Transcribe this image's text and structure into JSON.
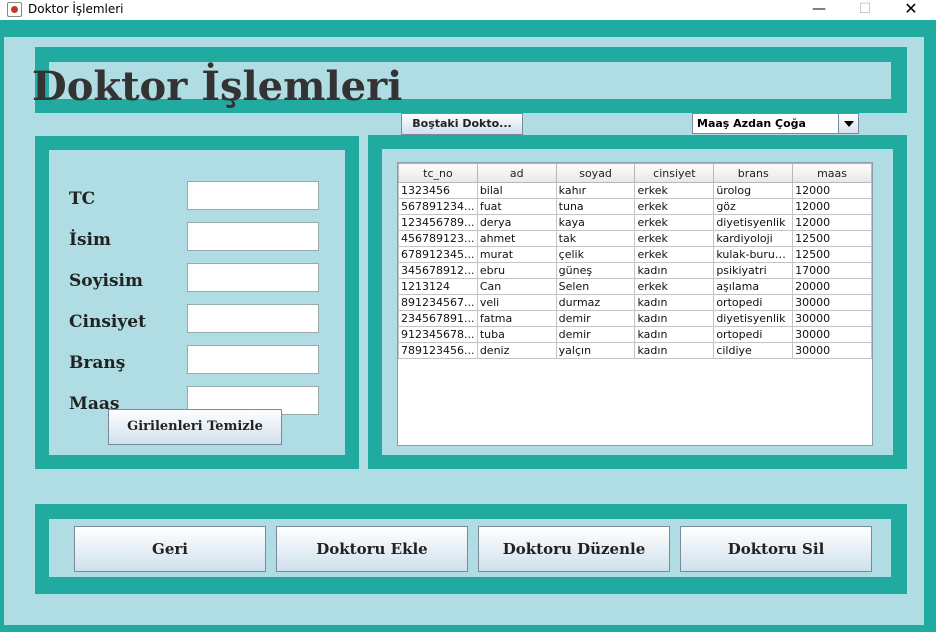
{
  "window": {
    "title": "Doktor İşlemleri",
    "min_glyph": "—",
    "max_glyph": "☐",
    "close_glyph": "✕"
  },
  "header": {
    "title": "Doktor İşlemleri"
  },
  "form": {
    "labels": {
      "tc": "TC",
      "name": "İsim",
      "surname": "Soyisim",
      "gender": "Cinsiyet",
      "branch": "Branş",
      "salary": "Maaş"
    },
    "values": {
      "tc": "",
      "name": "",
      "surname": "",
      "gender": "",
      "branch": "",
      "salary": ""
    },
    "clear_label": "Girilenleri Temizle"
  },
  "controls": {
    "bostaki_label": "Boştaki Dokto...",
    "sort_selected": "Maaş Azdan Çoğa"
  },
  "table": {
    "columns": [
      "tc_no",
      "ad",
      "soyad",
      "cinsiyet",
      "brans",
      "maas"
    ],
    "rows": [
      [
        "1323456",
        "bilal",
        "kahır",
        "erkek",
        "ürolog",
        "12000"
      ],
      [
        "567891234...",
        "fuat",
        "tuna",
        "erkek",
        "göz",
        "12000"
      ],
      [
        "123456789...",
        "derya",
        "kaya",
        "erkek",
        "diyetisyenlik",
        "12000"
      ],
      [
        "456789123...",
        "ahmet",
        "tak",
        "erkek",
        "kardiyoloji",
        "12500"
      ],
      [
        "678912345...",
        "murat",
        "çelik",
        "erkek",
        "kulak-burun-...",
        "12500"
      ],
      [
        "345678912...",
        "ebru",
        "güneş",
        "kadın",
        "psikiyatri",
        "17000"
      ],
      [
        "1213124",
        "Can",
        "Selen",
        "erkek",
        "aşılama",
        "20000"
      ],
      [
        "891234567...",
        "veli",
        "durmaz",
        "kadın",
        "ortopedi",
        "30000"
      ],
      [
        "234567891...",
        "fatma",
        "demir",
        "kadın",
        "diyetisyenlik",
        "30000"
      ],
      [
        "912345678...",
        "tuba",
        "demir",
        "kadın",
        "ortopedi",
        "30000"
      ],
      [
        "789123456...",
        "deniz",
        "yalçın",
        "kadın",
        "cildiye",
        "30000"
      ]
    ]
  },
  "actions": {
    "back": "Geri",
    "add": "Doktoru Ekle",
    "edit": "Doktoru Düzenle",
    "delete": "Doktoru Sil"
  },
  "colors": {
    "teal": "#20aaa0",
    "light": "#b0dde3"
  }
}
